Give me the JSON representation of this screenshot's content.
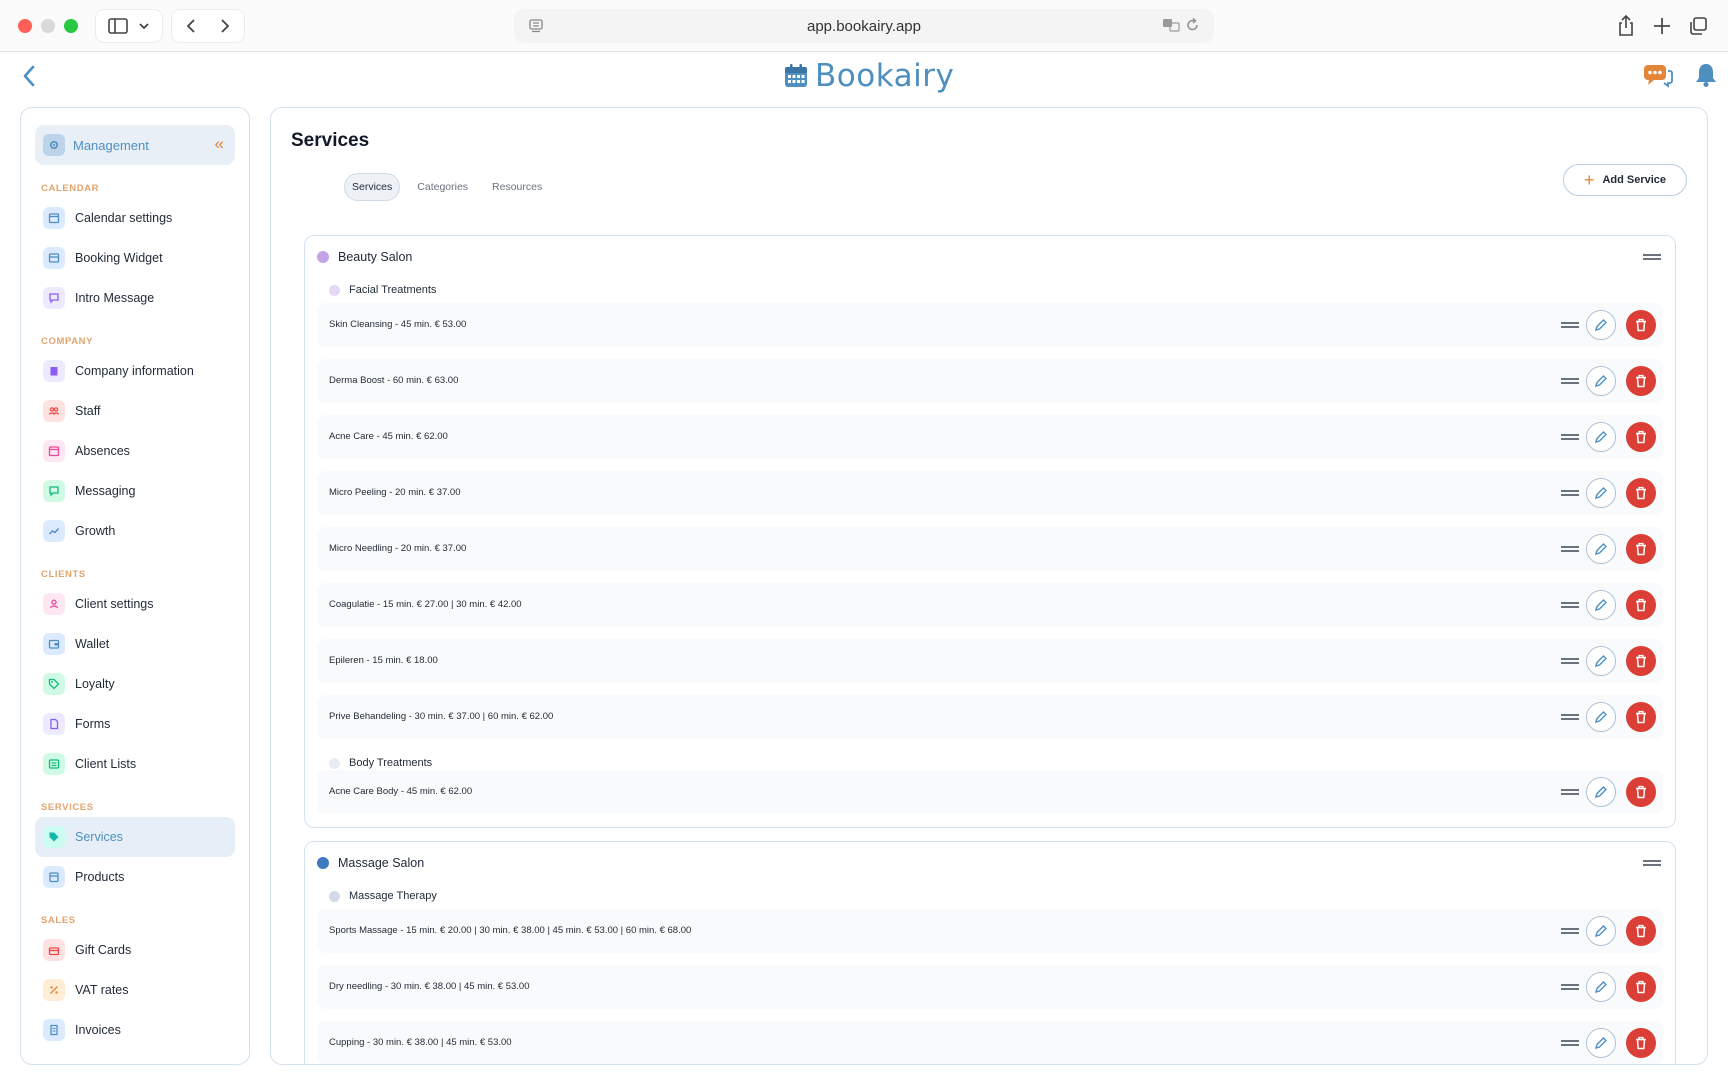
{
  "browser": {
    "url": "app.bookairy.app"
  },
  "app": {
    "logo_text": "Bookairy"
  },
  "sidebar": {
    "header_label": "Management",
    "sections": [
      {
        "title": "CALENDAR",
        "items": [
          {
            "label": "Calendar settings",
            "icon": "calendar-icon",
            "color": "#dbeafe"
          },
          {
            "label": "Booking Widget",
            "icon": "widget-icon",
            "color": "#dbeafe"
          },
          {
            "label": "Intro Message",
            "icon": "message-icon",
            "color": "#ede9fe"
          }
        ]
      },
      {
        "title": "COMPANY",
        "items": [
          {
            "label": "Company information",
            "icon": "building-icon",
            "color": "#ede9fe"
          },
          {
            "label": "Staff",
            "icon": "staff-icon",
            "color": "#fee2e2"
          },
          {
            "label": "Absences",
            "icon": "absence-calendar-icon",
            "color": "#fce7f3"
          },
          {
            "label": "Messaging",
            "icon": "chat-icon",
            "color": "#d1fae5"
          },
          {
            "label": "Growth",
            "icon": "growth-chart-icon",
            "color": "#dbeafe"
          }
        ]
      },
      {
        "title": "CLIENTS",
        "items": [
          {
            "label": "Client settings",
            "icon": "user-icon",
            "color": "#fce7f3"
          },
          {
            "label": "Wallet",
            "icon": "wallet-icon",
            "color": "#dbeafe"
          },
          {
            "label": "Loyalty",
            "icon": "tag-icon",
            "color": "#d1fae5"
          },
          {
            "label": "Forms",
            "icon": "form-icon",
            "color": "#ede9fe"
          },
          {
            "label": "Client Lists",
            "icon": "list-icon",
            "color": "#d1fae5"
          }
        ]
      },
      {
        "title": "SERVICES",
        "items": [
          {
            "label": "Services",
            "icon": "services-tag-icon",
            "color": "#ccfbf1",
            "active": true
          },
          {
            "label": "Products",
            "icon": "product-box-icon",
            "color": "#dbeafe"
          }
        ]
      },
      {
        "title": "SALES",
        "items": [
          {
            "label": "Gift Cards",
            "icon": "gift-icon",
            "color": "#fee2e2"
          },
          {
            "label": "VAT rates",
            "icon": "percent-icon",
            "color": "#ffedd5"
          },
          {
            "label": "Invoices",
            "icon": "invoice-icon",
            "color": "#dbeafe"
          }
        ]
      }
    ]
  },
  "main": {
    "title": "Services",
    "tabs": [
      {
        "label": "Services",
        "active": true
      },
      {
        "label": "Categories",
        "active": false
      },
      {
        "label": "Resources",
        "active": false
      }
    ],
    "add_button_label": "Add Service",
    "groups": [
      {
        "name": "Beauty Salon",
        "color": "#c4a3e6",
        "categories": [
          {
            "name": "Facial Treatments",
            "color": "#e4d8f5",
            "services": [
              "Skin Cleansing - 45 min. € 53.00",
              "Derma Boost - 60 min. € 63.00",
              "Acne Care - 45 min. € 62.00",
              "Micro Peeling - 20 min. € 37.00",
              "Micro Needling - 20 min. € 37.00",
              "Coagulatie - 15 min. € 27.00 | 30 min. € 42.00",
              "Epileren - 15 min. € 18.00",
              "Prive Behandeling - 30 min. € 37.00 | 60 min. € 62.00"
            ]
          },
          {
            "name": "Body Treatments",
            "color": "#e9ecf1",
            "services": [
              "Acne Care Body - 45 min. € 62.00"
            ]
          }
        ]
      },
      {
        "name": "Massage Salon",
        "color": "#3f78c2",
        "categories": [
          {
            "name": "Massage Therapy",
            "color": "#d1dae6",
            "services": [
              "Sports Massage - 15 min. € 20.00 | 30 min. € 38.00 | 45 min. € 53.00 | 60 min. € 68.00",
              "Dry needling - 30 min. € 38.00 | 45 min. € 53.00",
              "Cupping - 30 min. € 38.00 | 45 min. € 53.00"
            ]
          }
        ]
      }
    ]
  }
}
